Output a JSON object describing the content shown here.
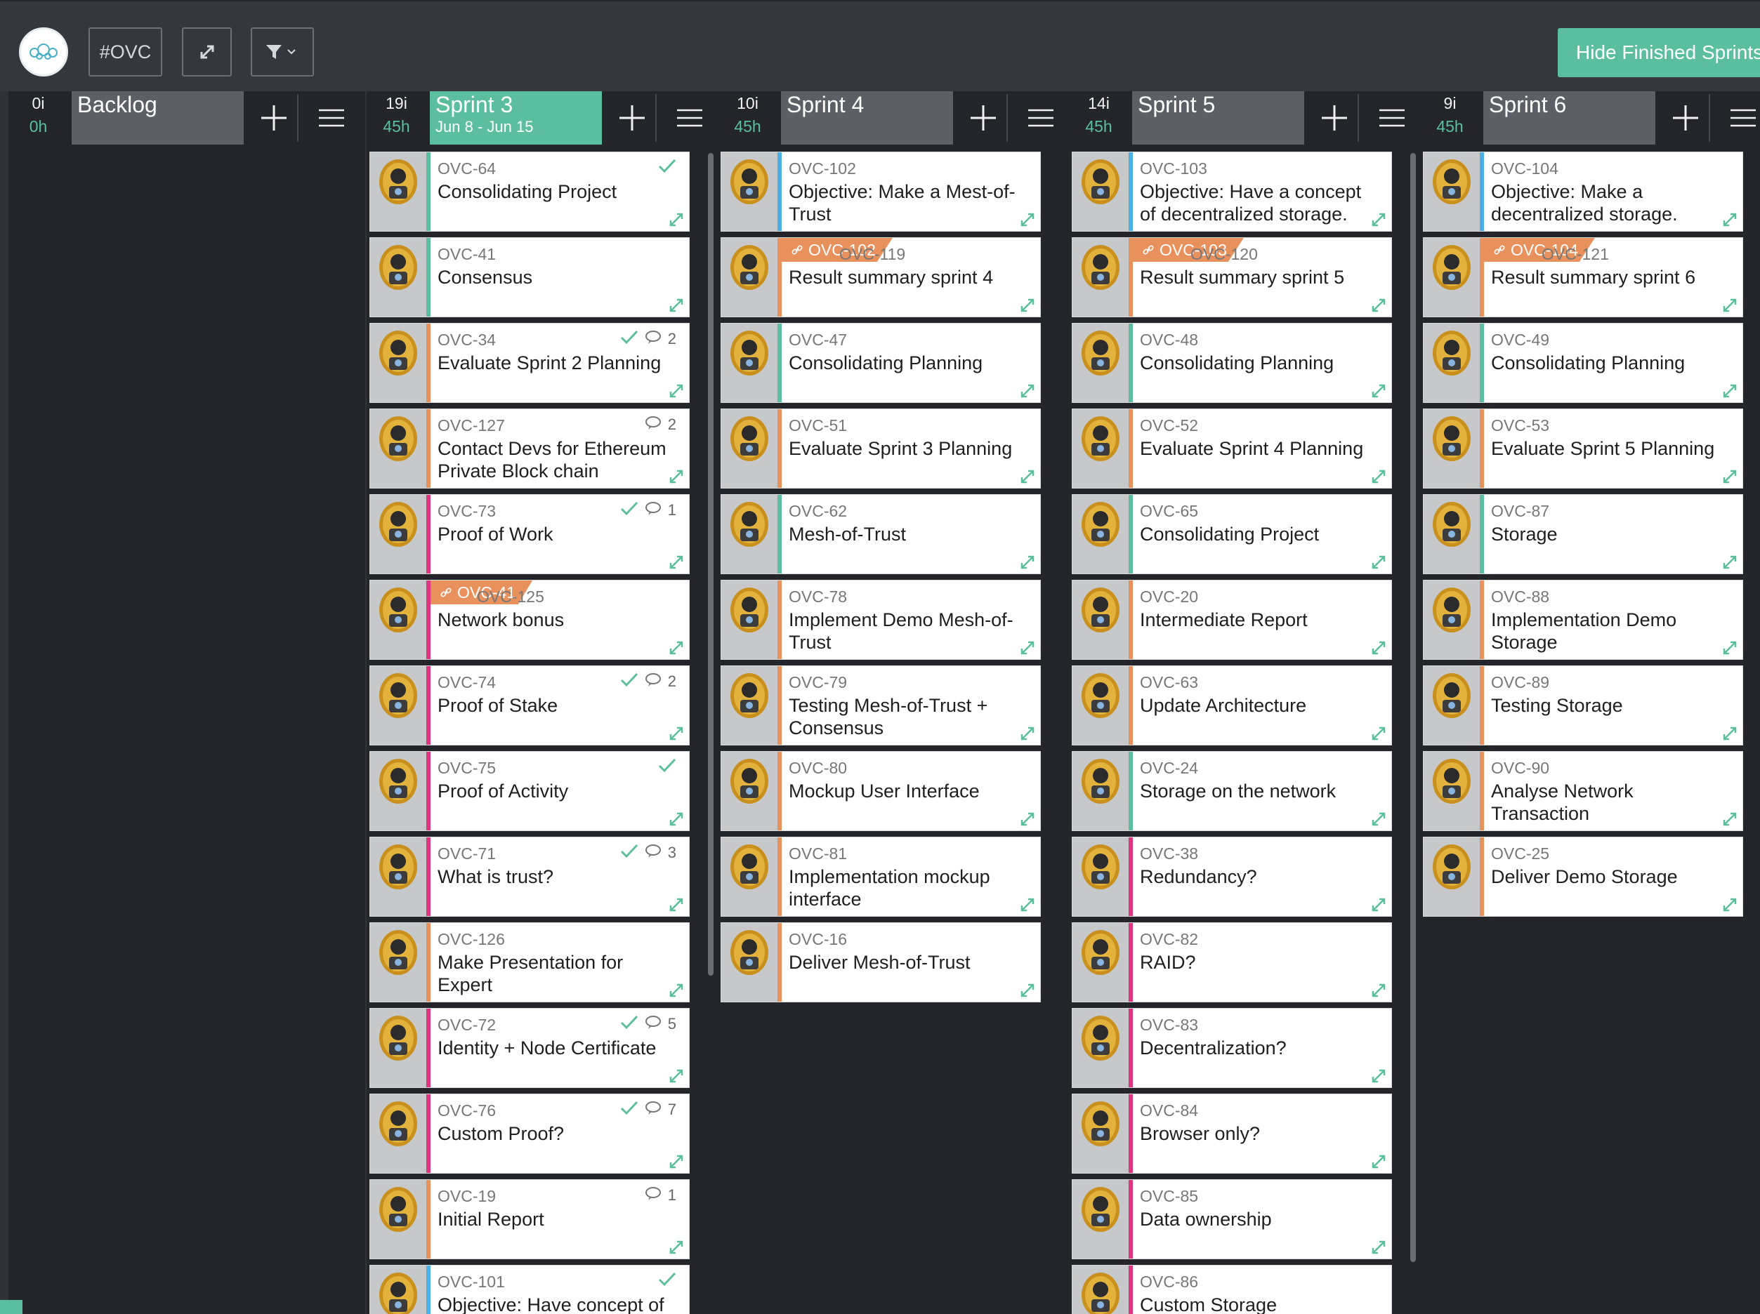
{
  "toolbar": {
    "project": "#OVC",
    "hide_button": "Hide Finished Sprints"
  },
  "colors": {
    "green": "#5bbf9f",
    "orange": "#e9915c",
    "pink": "#e0367f",
    "teal": "#5bbf9f",
    "blue": "#4ab0e6"
  },
  "columns": [
    {
      "name": "Backlog",
      "items": "0i",
      "hours": "0h",
      "dates": "",
      "cards": []
    },
    {
      "name": "Sprint 3",
      "items": "19i",
      "hours": "45h",
      "dates": "Jun 8 - Jun 15",
      "active": true,
      "cards": [
        {
          "key": "OVC-64",
          "title": "Consolidating Project",
          "bar": "teal",
          "check": true
        },
        {
          "key": "OVC-41",
          "title": "Consensus",
          "bar": "teal"
        },
        {
          "key": "OVC-34",
          "title": "Evaluate Sprint 2 Planning",
          "bar": "orange",
          "check": true,
          "comments": "2"
        },
        {
          "key": "OVC-127",
          "title": "Contact Devs for Ethereum Private Block chain",
          "bar": "orange",
          "comments": "2"
        },
        {
          "key": "OVC-73",
          "title": "Proof of Work",
          "bar": "pink",
          "check": true,
          "comments": "1"
        },
        {
          "key": "OVC-125",
          "title": "Network bonus",
          "bar": "pink",
          "tag": "OVC-41"
        },
        {
          "key": "OVC-74",
          "title": "Proof of Stake",
          "bar": "pink",
          "check": true,
          "comments": "2"
        },
        {
          "key": "OVC-75",
          "title": "Proof of Activity",
          "bar": "pink",
          "check": true
        },
        {
          "key": "OVC-71",
          "title": "What is trust?",
          "bar": "pink",
          "check": true,
          "comments": "3"
        },
        {
          "key": "OVC-126",
          "title": "Make Presentation for Expert",
          "bar": "orange"
        },
        {
          "key": "OVC-72",
          "title": "Identity + Node Certificate",
          "bar": "pink",
          "check": true,
          "comments": "5"
        },
        {
          "key": "OVC-76",
          "title": "Custom Proof?",
          "bar": "pink",
          "check": true,
          "comments": "7"
        },
        {
          "key": "OVC-19",
          "title": "Initial Report",
          "bar": "orange",
          "comments": "1"
        },
        {
          "key": "OVC-101",
          "title": "Objective: Have concept of",
          "bar": "blue",
          "check": true
        }
      ]
    },
    {
      "name": "Sprint 4",
      "items": "10i",
      "hours": "45h",
      "dates": "",
      "cards": [
        {
          "key": "OVC-102",
          "title": "Objective: Make a Mest-of-Trust",
          "bar": "blue"
        },
        {
          "key": "OVC-119",
          "title": "Result summary sprint 4",
          "bar": "orange",
          "tag": "OVC-102"
        },
        {
          "key": "OVC-47",
          "title": "Consolidating Planning",
          "bar": "teal"
        },
        {
          "key": "OVC-51",
          "title": "Evaluate Sprint 3 Planning",
          "bar": "orange"
        },
        {
          "key": "OVC-62",
          "title": "Mesh-of-Trust",
          "bar": "teal"
        },
        {
          "key": "OVC-78",
          "title": "Implement Demo Mesh-of-Trust",
          "bar": "orange"
        },
        {
          "key": "OVC-79",
          "title": "Testing Mesh-of-Trust + Consensus",
          "bar": "orange"
        },
        {
          "key": "OVC-80",
          "title": "Mockup User Interface",
          "bar": "orange"
        },
        {
          "key": "OVC-81",
          "title": "Implementation mockup interface",
          "bar": "orange"
        },
        {
          "key": "OVC-16",
          "title": "Deliver Mesh-of-Trust",
          "bar": "orange"
        }
      ]
    },
    {
      "name": "Sprint 5",
      "items": "14i",
      "hours": "45h",
      "dates": "",
      "cards": [
        {
          "key": "OVC-103",
          "title": "Objective: Have a concept of decentralized storage.",
          "bar": "blue"
        },
        {
          "key": "OVC-120",
          "title": "Result summary sprint 5",
          "bar": "orange",
          "tag": "OVC-103"
        },
        {
          "key": "OVC-48",
          "title": "Consolidating Planning",
          "bar": "teal"
        },
        {
          "key": "OVC-52",
          "title": "Evaluate Sprint 4 Planning",
          "bar": "orange"
        },
        {
          "key": "OVC-65",
          "title": "Consolidating Project",
          "bar": "teal"
        },
        {
          "key": "OVC-20",
          "title": "Intermediate Report",
          "bar": "orange"
        },
        {
          "key": "OVC-63",
          "title": "Update Architecture",
          "bar": "orange"
        },
        {
          "key": "OVC-24",
          "title": "Storage on the network",
          "bar": "teal"
        },
        {
          "key": "OVC-38",
          "title": "Redundancy?",
          "bar": "pink"
        },
        {
          "key": "OVC-82",
          "title": "RAID?",
          "bar": "pink"
        },
        {
          "key": "OVC-83",
          "title": "Decentralization?",
          "bar": "pink"
        },
        {
          "key": "OVC-84",
          "title": "Browser only?",
          "bar": "pink"
        },
        {
          "key": "OVC-85",
          "title": "Data ownership",
          "bar": "pink"
        },
        {
          "key": "OVC-86",
          "title": "Custom Storage",
          "bar": "pink"
        }
      ]
    },
    {
      "name": "Sprint 6",
      "items": "9i",
      "hours": "45h",
      "dates": "",
      "cards": [
        {
          "key": "OVC-104",
          "title": "Objective: Make a decentralized storage.",
          "bar": "blue"
        },
        {
          "key": "OVC-121",
          "title": "Result summary sprint 6",
          "bar": "orange",
          "tag": "OVC-104"
        },
        {
          "key": "OVC-49",
          "title": "Consolidating Planning",
          "bar": "teal"
        },
        {
          "key": "OVC-53",
          "title": "Evaluate Sprint 5 Planning",
          "bar": "orange"
        },
        {
          "key": "OVC-87",
          "title": "Storage",
          "bar": "teal"
        },
        {
          "key": "OVC-88",
          "title": "Implementation Demo Storage",
          "bar": "orange"
        },
        {
          "key": "OVC-89",
          "title": "Testing Storage",
          "bar": "orange"
        },
        {
          "key": "OVC-90",
          "title": "Analyse Network Transaction",
          "bar": "orange"
        },
        {
          "key": "OVC-25",
          "title": "Deliver Demo Storage",
          "bar": "orange"
        }
      ]
    }
  ]
}
